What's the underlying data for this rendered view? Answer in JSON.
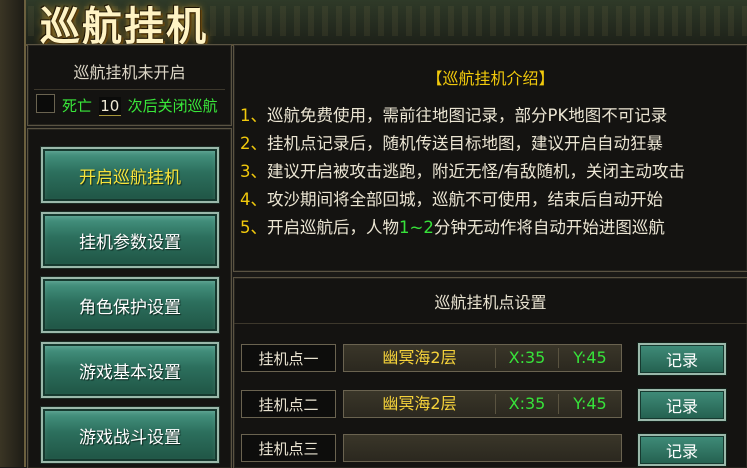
{
  "window": {
    "title": "巡航挂机"
  },
  "status": {
    "text": "巡航挂机未开启",
    "death_prefix": "死亡",
    "death_count": "10",
    "death_suffix": "次后关闭巡航"
  },
  "menu": {
    "items": [
      {
        "label": "开启巡航挂机",
        "active": true
      },
      {
        "label": "挂机参数设置",
        "active": false
      },
      {
        "label": "角色保护设置",
        "active": false
      },
      {
        "label": "游戏基本设置",
        "active": false
      },
      {
        "label": "游戏战斗设置",
        "active": false
      }
    ]
  },
  "intro": {
    "title": "【巡航挂机介绍】",
    "lines": [
      {
        "num": "1、",
        "text": "巡航免费使用，需前往地图记录，部分PK地图不可记录"
      },
      {
        "num": "2、",
        "text": "挂机点记录后，随机传送目标地图，建议开启自动狂暴"
      },
      {
        "num": "3、",
        "text": "建议开启被攻击逃跑，附近无怪/有敌随机，关闭主动攻击"
      },
      {
        "num": "4、",
        "text": "攻沙期间将全部回城，巡航不可使用，结束后自动开始"
      },
      {
        "num": "5、",
        "text": "开启巡航后，人物",
        "highlight": "1~2",
        "suffix": "分钟无动作将自动开始进图巡航"
      }
    ]
  },
  "points": {
    "title": "巡航挂机点设置",
    "record_label": "记录",
    "rows": [
      {
        "label": "挂机点一",
        "map": "幽冥海2层",
        "x": "X:35",
        "y": "Y:45"
      },
      {
        "label": "挂机点二",
        "map": "幽冥海2层",
        "x": "X:35",
        "y": "Y:45"
      },
      {
        "label": "挂机点三",
        "map": "",
        "x": "",
        "y": ""
      }
    ]
  },
  "colors": {
    "accent_yellow": "#f1c90c",
    "highlight_green": "#37e23a",
    "button_teal": "#2c6f5d"
  }
}
